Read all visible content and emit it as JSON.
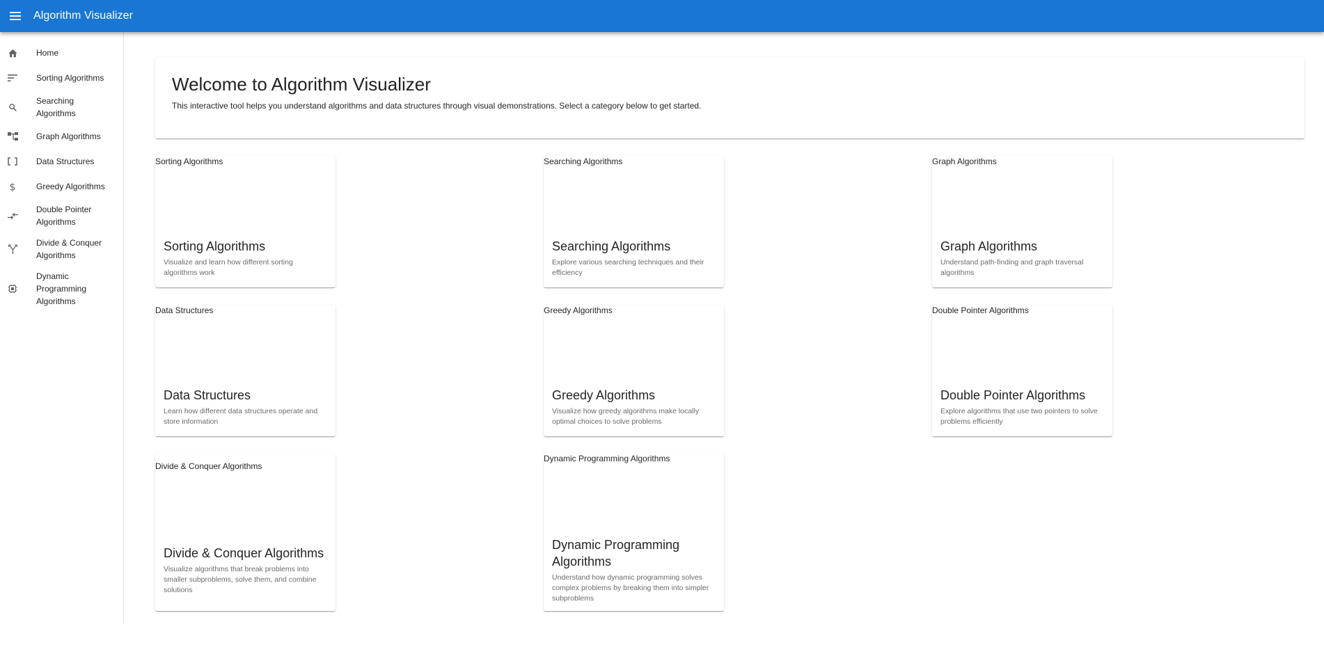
{
  "app": {
    "title": "Algorithm Visualizer",
    "accent": "#1976d2"
  },
  "sidebar": {
    "items": [
      {
        "label": "Home",
        "icon": "home-icon"
      },
      {
        "label": "Sorting Algorithms",
        "icon": "sort-icon"
      },
      {
        "label": "Searching Algorithms",
        "icon": "search-icon"
      },
      {
        "label": "Graph Algorithms",
        "icon": "account-tree-icon"
      },
      {
        "label": "Data Structures",
        "icon": "data-array-icon"
      },
      {
        "label": "Greedy Algorithms",
        "icon": "dollar-icon"
      },
      {
        "label": "Double Pointer Algorithms",
        "icon": "compare-arrows-icon"
      },
      {
        "label": "Divide & Conquer Algorithms",
        "icon": "call-split-icon"
      },
      {
        "label": "Dynamic Programming Algorithms",
        "icon": "memory-icon"
      }
    ]
  },
  "welcome": {
    "title": "Welcome to Algorithm Visualizer",
    "text": "This interactive tool helps you understand algorithms and data structures through visual demonstrations. Select a category below to get started."
  },
  "cards": [
    {
      "alt": "Sorting Algorithms",
      "title": "Sorting Algorithms",
      "desc": "Visualize and learn how different sorting algorithms work"
    },
    {
      "alt": "Searching Algorithms",
      "title": "Searching Algorithms",
      "desc": "Explore various searching techniques and their efficiency"
    },
    {
      "alt": "Graph Algorithms",
      "title": "Graph Algorithms",
      "desc": "Understand path-finding and graph traversal algorithms"
    },
    {
      "alt": "Data Structures",
      "title": "Data Structures",
      "desc": "Learn how different data structures operate and store information"
    },
    {
      "alt": "Greedy Algorithms",
      "title": "Greedy Algorithms",
      "desc": "Visualize how greedy algorithms make locally optimal choices to solve problems"
    },
    {
      "alt": "Double Pointer Algorithms",
      "title": "Double Pointer Algorithms",
      "desc": "Explore algorithms that use two pointers to solve problems efficiently"
    },
    {
      "alt": "Divide & Conquer Algorithms",
      "title": "Divide & Conquer Algorithms",
      "desc": "Visualize algorithms that break problems into smaller subproblems, solve them, and combine solutions"
    },
    {
      "alt": "Dynamic Programming Algorithms",
      "title": "Dynamic Programming Algorithms",
      "desc": "Understand how dynamic programming solves complex problems by breaking them into simpler subproblems"
    }
  ]
}
